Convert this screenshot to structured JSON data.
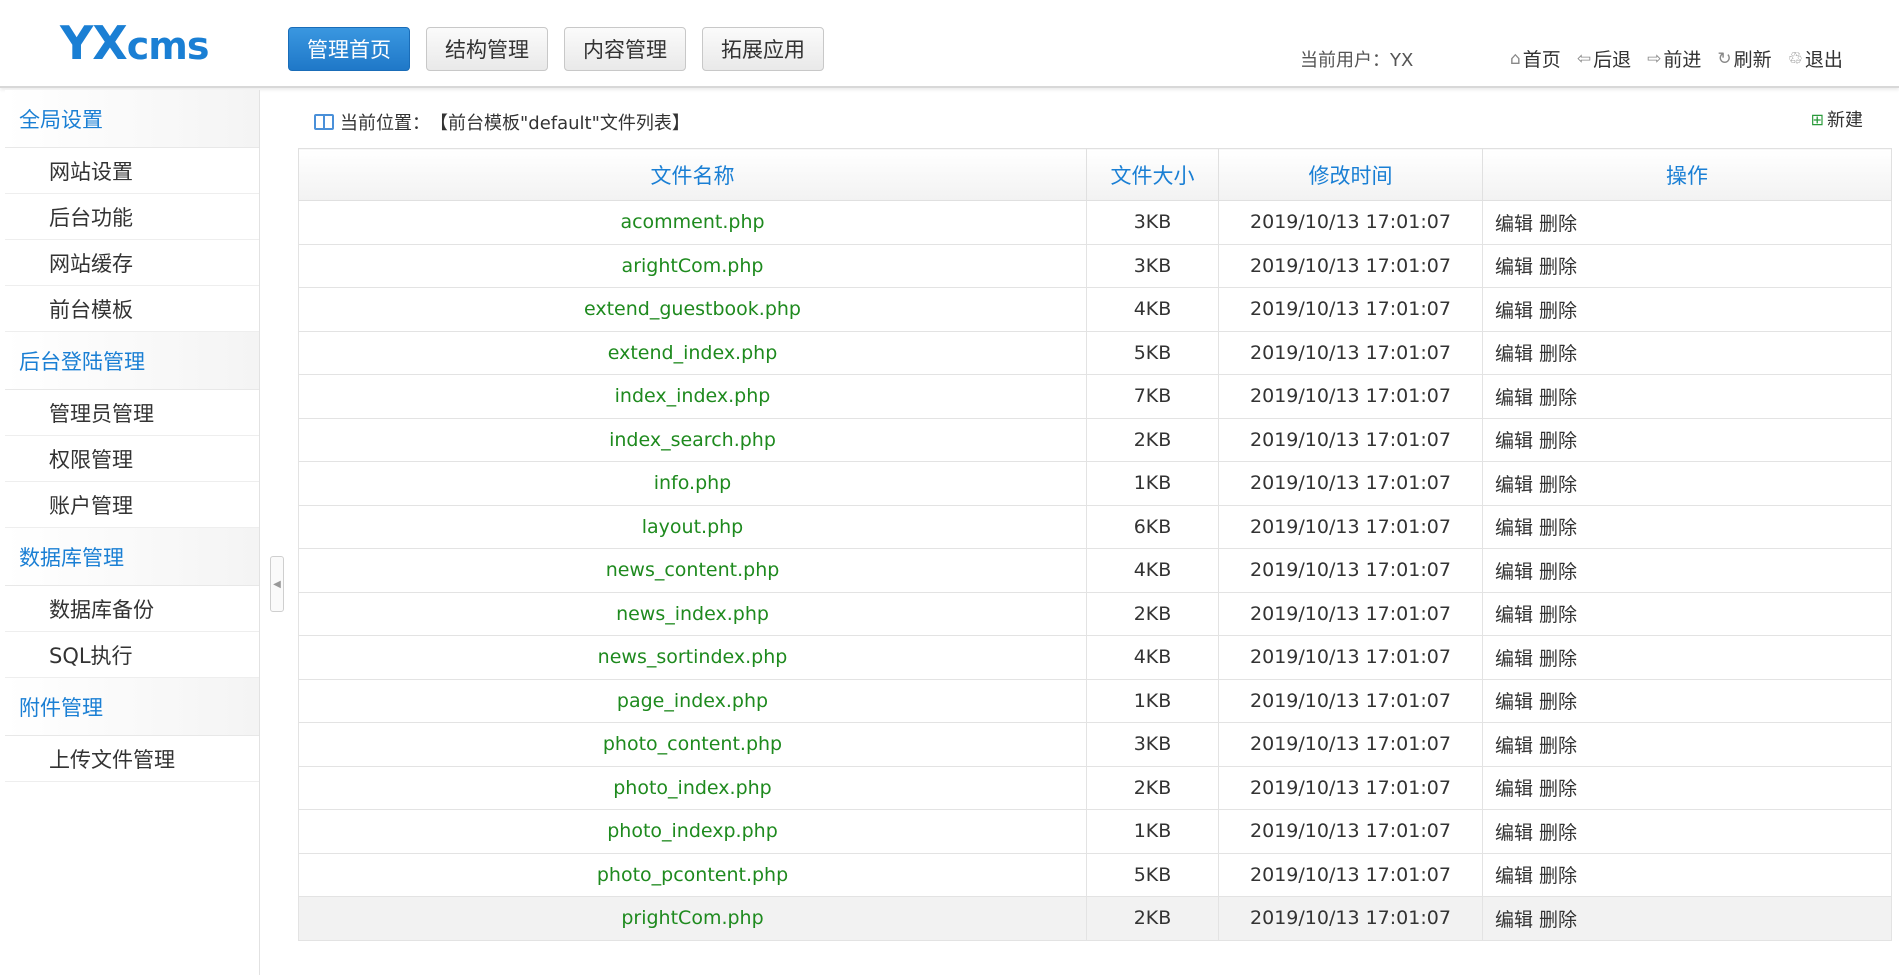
{
  "header": {
    "logo_main": "YX",
    "logo_small": "cms",
    "nav": [
      "管理首页",
      "结构管理",
      "内容管理",
      "拓展应用"
    ],
    "current_user_label": "当前用户：YX",
    "toplinks": [
      {
        "icon": "home-icon",
        "glyph": "⌂",
        "label": "首页"
      },
      {
        "icon": "back-icon",
        "glyph": "⇦",
        "label": "后退"
      },
      {
        "icon": "forward-icon",
        "glyph": "⇨",
        "label": "前进"
      },
      {
        "icon": "refresh-icon",
        "glyph": "↻",
        "label": "刷新"
      },
      {
        "icon": "logout-icon",
        "glyph": "♲",
        "label": "退出"
      }
    ]
  },
  "sidebar": {
    "groups": [
      {
        "title": "全局设置",
        "items": [
          "网站设置",
          "后台功能",
          "网站缓存",
          "前台模板"
        ]
      },
      {
        "title": "后台登陆管理",
        "items": [
          "管理员管理",
          "权限管理",
          "账户管理"
        ]
      },
      {
        "title": "数据库管理",
        "items": [
          "数据库备份",
          "SQL执行"
        ]
      },
      {
        "title": "附件管理",
        "items": [
          "上传文件管理"
        ]
      }
    ]
  },
  "main": {
    "breadcrumb_label": "当前位置：",
    "breadcrumb_value": "【前台模板\"default\"文件列表】",
    "new_label": "新建",
    "columns": [
      "文件名称",
      "文件大小",
      "修改时间",
      "操作"
    ],
    "edit_label": "编辑",
    "delete_label": "删除",
    "rows": [
      {
        "name": "acomment.php",
        "size": "3KB",
        "time": "2019/10/13 17:01:07"
      },
      {
        "name": "arightCom.php",
        "size": "3KB",
        "time": "2019/10/13 17:01:07"
      },
      {
        "name": "extend_guestbook.php",
        "size": "4KB",
        "time": "2019/10/13 17:01:07"
      },
      {
        "name": "extend_index.php",
        "size": "5KB",
        "time": "2019/10/13 17:01:07"
      },
      {
        "name": "index_index.php",
        "size": "7KB",
        "time": "2019/10/13 17:01:07"
      },
      {
        "name": "index_search.php",
        "size": "2KB",
        "time": "2019/10/13 17:01:07"
      },
      {
        "name": "info.php",
        "size": "1KB",
        "time": "2019/10/13 17:01:07"
      },
      {
        "name": "layout.php",
        "size": "6KB",
        "time": "2019/10/13 17:01:07"
      },
      {
        "name": "news_content.php",
        "size": "4KB",
        "time": "2019/10/13 17:01:07"
      },
      {
        "name": "news_index.php",
        "size": "2KB",
        "time": "2019/10/13 17:01:07"
      },
      {
        "name": "news_sortindex.php",
        "size": "4KB",
        "time": "2019/10/13 17:01:07"
      },
      {
        "name": "page_index.php",
        "size": "1KB",
        "time": "2019/10/13 17:01:07"
      },
      {
        "name": "photo_content.php",
        "size": "3KB",
        "time": "2019/10/13 17:01:07"
      },
      {
        "name": "photo_index.php",
        "size": "2KB",
        "time": "2019/10/13 17:01:07"
      },
      {
        "name": "photo_indexp.php",
        "size": "1KB",
        "time": "2019/10/13 17:01:07"
      },
      {
        "name": "photo_pcontent.php",
        "size": "5KB",
        "time": "2019/10/13 17:01:07"
      },
      {
        "name": "prightCom.php",
        "size": "2KB",
        "time": "2019/10/13 17:01:07"
      }
    ]
  },
  "colors": {
    "accent": "#1a7fd4",
    "filename": "#1e8a1e"
  }
}
